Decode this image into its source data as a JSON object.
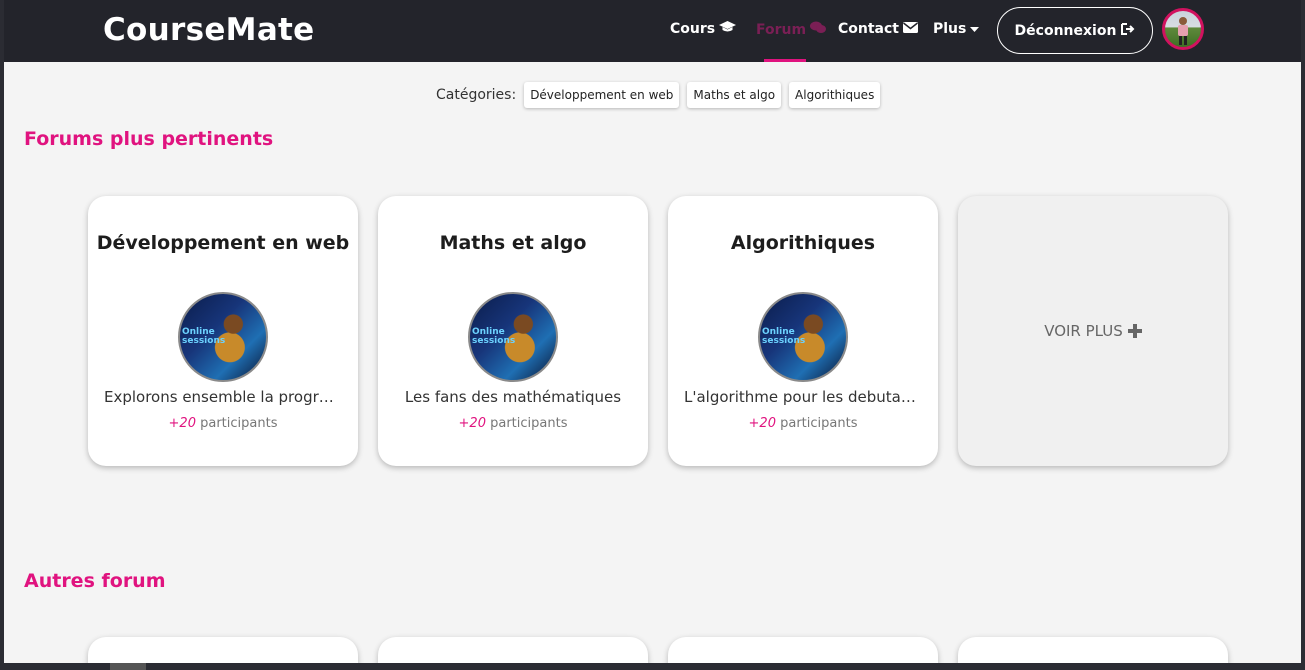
{
  "brand": "CourseMate",
  "nav": {
    "cours": "Cours",
    "forum": "Forum",
    "contact": "Contact",
    "plus": "Plus",
    "logout": "Déconnexion"
  },
  "categories": {
    "label": "Catégories:",
    "items": [
      "Développement en web",
      "Maths et algo",
      "Algorithiques"
    ]
  },
  "sections": {
    "pertinents": "Forums plus pertinents",
    "autres": "Autres forum"
  },
  "cards": [
    {
      "title": "Développement en web",
      "desc": "Explorons ensemble la programmation",
      "count": "+20",
      "participants": "participants",
      "thumb_text": "Online\nsessions"
    },
    {
      "title": "Maths et algo",
      "desc": "Les fans des mathématiques",
      "count": "+20",
      "participants": "participants",
      "thumb_text": "Online\nsessions"
    },
    {
      "title": "Algorithiques",
      "desc": "L'algorithme pour les debutants",
      "count": "+20",
      "participants": "participants",
      "thumb_text": "Online\nsessions"
    }
  ],
  "voir_plus": "VOIR PLUS",
  "icons": {
    "cours": "graduation-cap-icon",
    "forum": "comments-icon",
    "contact": "envelope-icon",
    "plus": "caret-down-icon",
    "logout": "sign-out-icon",
    "voir_plus": "plus-icon"
  },
  "colors": {
    "accent": "#e0137f",
    "navbar": "#23242b",
    "background": "#f4f4f4"
  }
}
